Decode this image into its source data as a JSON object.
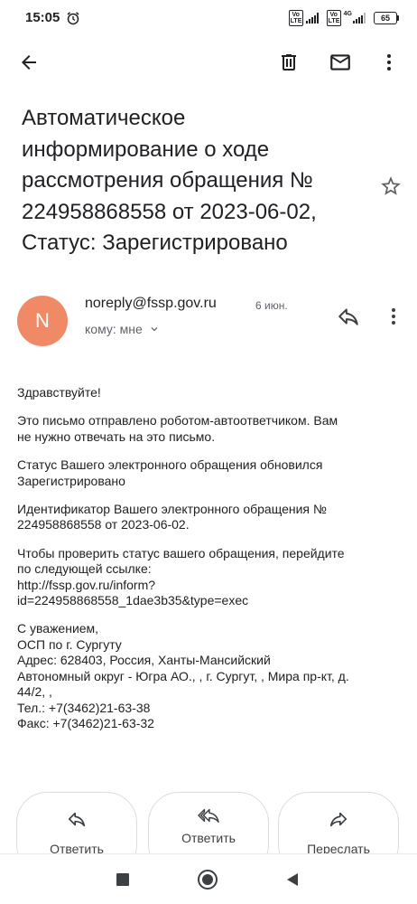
{
  "status_bar": {
    "time": "15:05",
    "volte_1": "Vo LTE",
    "volte_2": "Vo LTE",
    "network": "4G",
    "battery": "65"
  },
  "app_bar": {
    "back_icon": "arrow-back-icon",
    "delete_icon": "trash-icon",
    "mark_unread_icon": "mail-icon",
    "more_icon": "more-vert-icon"
  },
  "email": {
    "subject": "Автоматическое информирование о ходе рассмотрения обращения № 224958868558 от 2023-06-02, Статус: Зарегистрировано",
    "star_icon": "star-outline-icon",
    "sender": {
      "avatar_letter": "N",
      "avatar_color": "#f08a66",
      "address": "noreply@fssp.gov.ru",
      "date": "6 июн.",
      "recipient": "кому: мне"
    },
    "body": [
      [
        "Здравствуйте!"
      ],
      [
        "Это письмо отправлено роботом-автоответчиком. Вам",
        "не нужно отвечать на это письмо."
      ],
      [
        "Статус Вашего электронного обращения обновился",
        "Зарегистрировано"
      ],
      [
        "Идентификатор Вашего электронного обращения №",
        "224958868558 от 2023-06-02."
      ],
      [
        "Чтобы проверить статус вашего обращения, перейдите",
        "по следующей ссылке:",
        "http://fssp.gov.ru/inform?",
        "id=224958868558_1dae3b35&type=exec"
      ],
      [
        "С уважением,",
        "ОСП по г. Сургуту",
        "Адрес: 628403, Россия, Ханты-Мансийский",
        "Автономный округ - Югра АО., , г. Сургут, , Мира пр-кт, д.",
        "44/2, ,",
        "Тел.: +7(3462)21-63-38",
        "Факс: +7(3462)21-63-32"
      ]
    ]
  },
  "actions": {
    "reply": "Ответить",
    "reply_all": "Ответить",
    "forward": "Переслать"
  },
  "nav_bar": {
    "recents_icon": "square-icon",
    "home_icon": "circle-icon",
    "back_icon": "triangle-back-icon"
  }
}
